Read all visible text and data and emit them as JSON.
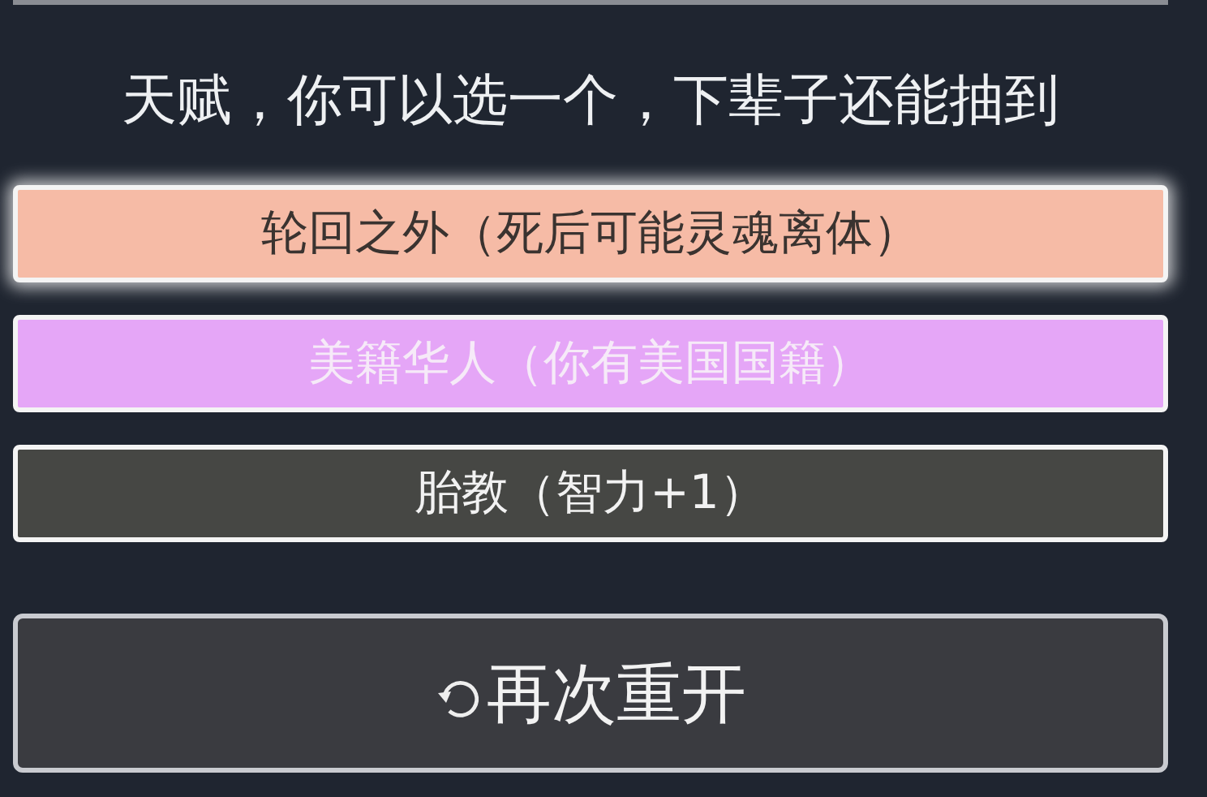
{
  "title": "天赋，你可以选一个，下辈子还能抽到",
  "talents": [
    {
      "label": "轮回之外（死后可能灵魂离体）",
      "kind": "legendary",
      "color": "#f6bba6",
      "selected": true
    },
    {
      "label": "美籍华人（你有美国国籍）",
      "kind": "epic",
      "color": "#e5a6f7",
      "selected": false
    },
    {
      "label": "胎教（智力+1）",
      "kind": "common",
      "color": "#464744",
      "selected": false
    }
  ],
  "restart_button": {
    "label": "再次重开"
  }
}
